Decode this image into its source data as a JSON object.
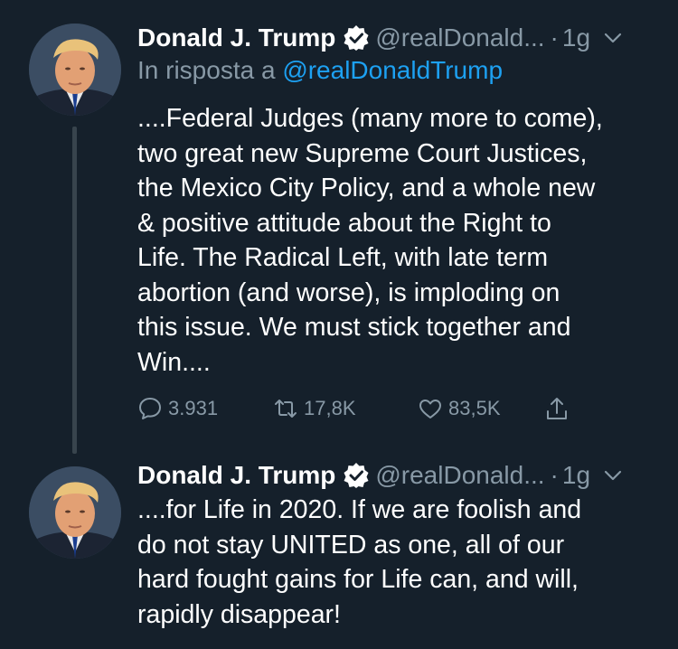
{
  "tweets": [
    {
      "author_name": "Donald J. Trump",
      "handle": "@realDonald...",
      "dot": "·",
      "time": "1g",
      "reply_prefix": "In risposta a",
      "reply_handle": "@realDonaldTrump",
      "text": "....Federal Judges (many more to come),\ntwo great new Supreme Court Justices,\nthe Mexico City Policy, and a whole new\n& positive attitude about the Right to\nLife. The Radical Left, with late term\nabortion (and worse), is imploding on\nthis issue. We must stick together and\nWin....",
      "replies": "3.931",
      "retweets": "17,8K",
      "likes": "83,5K"
    },
    {
      "author_name": "Donald J. Trump",
      "handle": "@realDonald...",
      "dot": "·",
      "time": "1g",
      "text": "....for Life in 2020. If we are foolish and\ndo not stay UNITED as one, all of our\nhard fought gains for Life can, and will,\nrapidly disappear!"
    }
  ],
  "icons": [
    "verified-badge-icon",
    "chevron-down-icon",
    "reply-icon",
    "retweet-icon",
    "like-icon",
    "share-icon"
  ],
  "colors": {
    "background": "#15202b",
    "text": "#ffffff",
    "secondary": "#8899a6",
    "link": "#1da1f2"
  }
}
